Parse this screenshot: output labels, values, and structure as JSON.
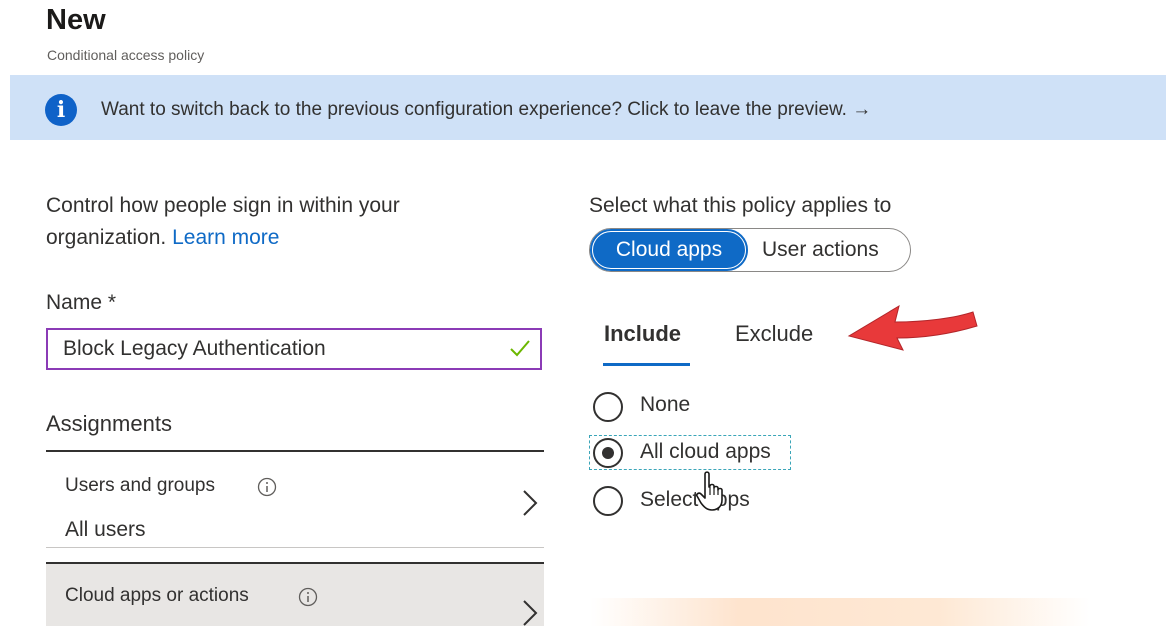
{
  "header": {
    "title": "New",
    "subtitle": "Conditional access policy"
  },
  "banner": {
    "icon": "info-icon",
    "text": "Want to switch back to the previous configuration experience? Click to leave the preview. →"
  },
  "intro": {
    "line1": "Control how people sign in within your",
    "line2_prefix": "organization.",
    "learn_more": "Learn more"
  },
  "name_field": {
    "label": "Name *",
    "value": "Block Legacy Authentication",
    "valid": true
  },
  "assignments": {
    "heading": "Assignments",
    "items": [
      {
        "label": "Users and groups",
        "value": "All users"
      },
      {
        "label": "Cloud apps or actions",
        "value": ""
      }
    ]
  },
  "applies_to": {
    "label": "Select what this policy applies to",
    "options": [
      "Cloud apps",
      "User actions"
    ],
    "selected": "Cloud apps"
  },
  "tabs": {
    "items": [
      "Include",
      "Exclude"
    ],
    "active": "Include"
  },
  "include_options": {
    "items": [
      {
        "label": "None",
        "selected": false
      },
      {
        "label": "All cloud apps",
        "selected": true
      },
      {
        "label": "Select apps",
        "selected": false
      }
    ]
  },
  "colors": {
    "accent": "#0f6ac6",
    "banner_bg": "#cfe1f7",
    "input_border": "#8b3bb6",
    "annotation_arrow": "#e8393a"
  }
}
